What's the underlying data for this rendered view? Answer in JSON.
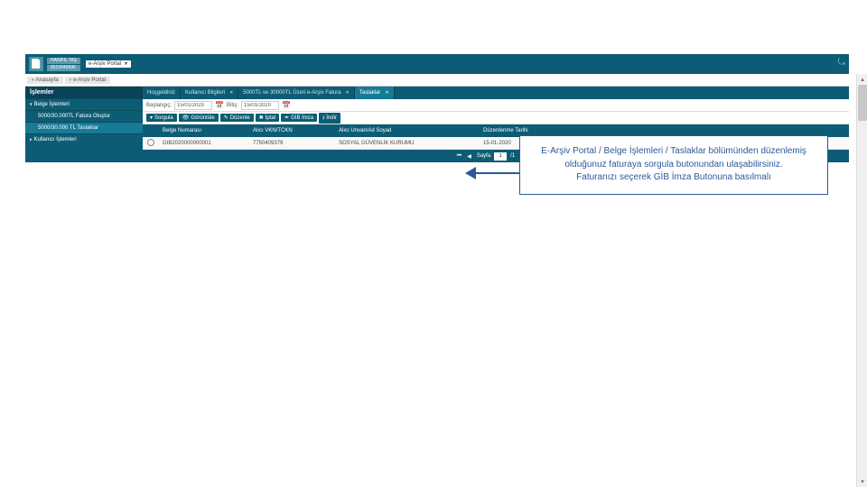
{
  "header": {
    "user_name": "HANİFE TAŞ",
    "user_id": "8510040696",
    "portal_selector": "e-Arşiv Portal"
  },
  "breadcrumb": {
    "home": "Anasayfa",
    "current": "e-Arşiv Portal"
  },
  "sidebar": {
    "title": "İşlemler",
    "items": [
      {
        "label": "Belge İşlemleri",
        "type": "group"
      },
      {
        "label": "5000/30.000TL Fatura Oluştur",
        "type": "sub",
        "active": false
      },
      {
        "label": "5000/30.000 TL Taslaklar",
        "type": "sub",
        "active": true
      },
      {
        "label": "Kullanıcı İşlemleri",
        "type": "group_collapsed"
      }
    ]
  },
  "tabs": [
    {
      "label": "Hoşgeldiniz",
      "closable": false,
      "active": false
    },
    {
      "label": "Kullanıcı Bilgileri",
      "closable": true,
      "active": false
    },
    {
      "label": "5000TL ve 30000TL Üzeri e-Arşiv Fatura",
      "closable": true,
      "active": false
    },
    {
      "label": "Taslaklar",
      "closable": true,
      "active": true
    }
  ],
  "filters": {
    "start_label": "Başlangıç:",
    "start_value": "15/01/2020",
    "end_label": "Bitiş:",
    "end_value": "15/01/2020"
  },
  "toolbar": {
    "sorgula": "Sorgula",
    "goruntule": "Görüntüle",
    "duzenle": "Düzenle",
    "iptal": "İptal",
    "gibimza": "GİB İmza",
    "indir": "İndir"
  },
  "table": {
    "headers": {
      "belge_no": "Belge Numarası",
      "alici_vkn": "Alıcı VKN/TCKN",
      "alici_unvan": "Alıcı Unvan/Ad Soyad",
      "duzenlenme": "Düzenlenme Tarihi"
    },
    "rows": [
      {
        "belge_no": "GIB2020000000001",
        "alici_vkn": "7750409379",
        "alici_unvan": "SOSYAL GÜVENLİK KURUMU",
        "duzenlenme": "15-01-2020"
      }
    ]
  },
  "pager": {
    "label": "Sayfa",
    "page": "1",
    "total": "/1"
  },
  "callout": {
    "line1": "E-Arşiv Portal / Belge İşlemleri / Taslaklar bölümünden düzenlemiş",
    "line2": "olduğunuz faturaya sorgula butonundan ulaşabilirsiniz.",
    "line3": "Faturanızı seçerek GİB İmza Butonuna basılmalı"
  }
}
